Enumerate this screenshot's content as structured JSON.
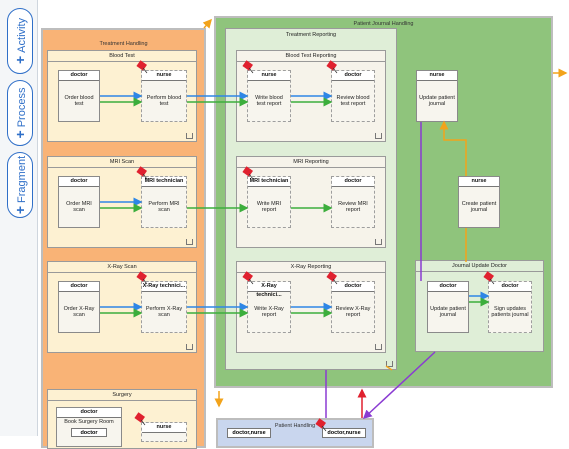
{
  "palette": {
    "activity": "Activity",
    "process": "Process",
    "fragment": "Fragment",
    "plus": "+"
  },
  "labels": {
    "treatment_handling": "Treatment Handling",
    "patient_journal_handling": "Patient Journal Handling",
    "treatment_reporting": "Treatment Reporting",
    "blood_test": "Blood Test",
    "mri_scan": "MRI Scan",
    "xray_scan": "X-Ray Scan",
    "surgery": "Surgery",
    "blood_test_reporting": "Blood Test Reporting",
    "mri_reporting": "MRI Reporting",
    "xray_reporting": "X-Ray Reporting",
    "journal_update": "Journal Update Doctor",
    "patient_handling": "Patient Handling"
  },
  "actors": {
    "doctor": "doctor",
    "nurse": "nurse",
    "mri_technician": "MRI technician",
    "xray_technician": "X-Ray technici...",
    "doctor_nurse": "doctor,nurse"
  },
  "tasks": {
    "order_blood_test": "Order blood test",
    "perform_blood_test": "Perform blood test",
    "order_mri_scan": "Order MRI scan",
    "perform_mri_scan": "Perform MRI scan",
    "order_xray_scan": "Order X-Ray scan",
    "perform_xray_scan": "Perform X-Ray scan",
    "book_surgery_room": "Book Surgery Room",
    "write_blood_test_report": "Write blood test report",
    "review_blood_test_report": "Review blood test report",
    "write_mri_report": "Write MRI report",
    "review_mri_report": "Review MRI report",
    "write_xray_report": "Write X-Ray report",
    "review_xray_report": "Review X-Ray report",
    "update_patient_journal": "Update patient journal",
    "create_patient_journal": "Create patient journal",
    "sign_updates": "Sign updates patients journal"
  },
  "markers": {
    "collapse": "n"
  },
  "colors": {
    "treatment_handling_bg": "#f9b376",
    "blood_lane_bg": "#fdf1d2",
    "patient_journal_bg": "#8fc47c",
    "reporting_bg": "#dfeed7",
    "patient_handling_bg": "#c9d6ee",
    "flow_blue": "#2e86e6",
    "flow_green": "#3cae3c",
    "flow_purple": "#8a3bd2",
    "flow_orange": "#f2a31b",
    "flow_red": "#e0212f"
  }
}
